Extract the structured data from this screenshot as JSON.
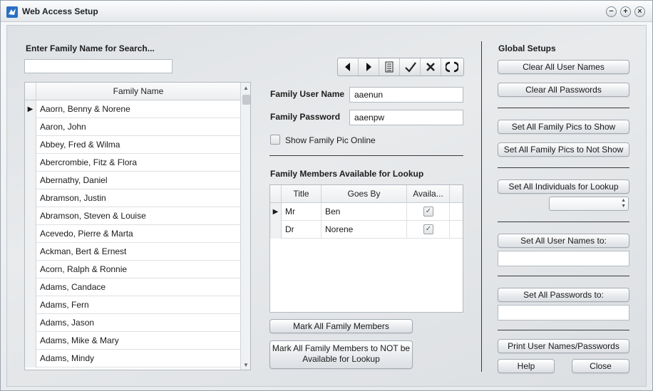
{
  "window": {
    "title": "Web Access Setup"
  },
  "search": {
    "label": "Enter Family Name for Search...",
    "value": ""
  },
  "family_grid": {
    "header": "Family Name",
    "rows": [
      "Aaorn, Benny & Norene",
      "Aaron, John",
      "Abbey, Fred & Wilma",
      "Abercrombie, Fitz & Flora",
      "Abernathy, Daniel",
      "Abramson, Justin",
      "Abramson, Steven & Louise",
      "Acevedo, Pierre & Marta",
      "Ackman, Bert & Ernest",
      "Acorn, Ralph & Ronnie",
      "Adams, Candace",
      "Adams, Fern",
      "Adams, Jason",
      "Adams, Mike & Mary",
      "Adams, Mindy"
    ],
    "selected_index": 0
  },
  "family": {
    "user_name_label": "Family User Name",
    "user_name_value": "aaenun",
    "password_label": "Family Password",
    "password_value": "aaenpw",
    "show_pic_label": "Show Family Pic Online",
    "show_pic_checked": false
  },
  "members": {
    "label": "Family Members Available for Lookup",
    "columns": [
      "Title",
      "Goes By",
      "Availa..."
    ],
    "rows": [
      {
        "title": "Mr",
        "goes_by": "Ben",
        "available": true
      },
      {
        "title": "Dr",
        "goes_by": "Norene",
        "available": true
      }
    ],
    "selected_index": 0
  },
  "buttons": {
    "mark_all": "Mark All Family Members",
    "mark_all_not": "Mark All Family Members to NOT be Available for Lookup"
  },
  "global": {
    "label": "Global Setups",
    "clear_user_names": "Clear All User Names",
    "clear_passwords": "Clear All Passwords",
    "pics_show": "Set All Family Pics to Show",
    "pics_not_show": "Set All Family Pics to Not Show",
    "individuals_lookup": "Set All Individuals for Lookup",
    "individuals_select_value": "",
    "set_user_names": "Set All User Names to:",
    "set_user_names_value": "",
    "set_passwords": "Set All Passwords to:",
    "set_passwords_value": "",
    "print": "Print User Names/Passwords",
    "help": "Help",
    "close": "Close"
  },
  "icons": {
    "app": "app-logo-icon",
    "nav": [
      "previous-icon",
      "next-icon",
      "list-icon",
      "save-check-icon",
      "cancel-x-icon",
      "refresh-icon"
    ]
  },
  "colors": {
    "app_icon": "#2a6fc4"
  }
}
